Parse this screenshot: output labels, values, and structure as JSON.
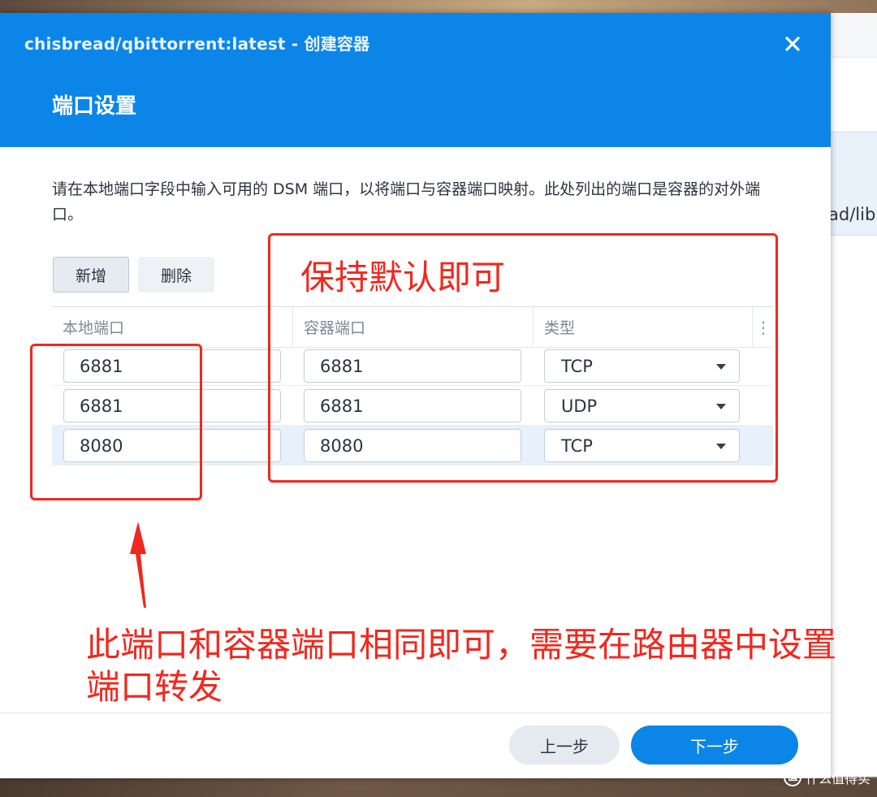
{
  "background": {
    "clipped_text": "ad/lib",
    "watermark": "什么值得买",
    "watermark_logo": "值"
  },
  "dialog": {
    "window_title": "chisbread/qbittorrent:latest - 创建容器",
    "step_title": "端口设置",
    "description": "请在本地端口字段中输入可用的 DSM 端口，以将端口与容器端口映射。此处列出的端口是容器的对外端口。",
    "toolbar": {
      "add_label": "新增",
      "delete_label": "删除"
    },
    "grid": {
      "columns": [
        "本地端口",
        "容器端口",
        "类型"
      ],
      "rows": [
        {
          "local_port": "6881",
          "container_port": "6881",
          "type": "TCP"
        },
        {
          "local_port": "6881",
          "container_port": "6881",
          "type": "UDP"
        },
        {
          "local_port": "8080",
          "container_port": "8080",
          "type": "TCP"
        }
      ],
      "selected_row": 3
    },
    "footer": {
      "prev_label": "上一步",
      "next_label": "下一步"
    }
  },
  "annotations": {
    "keep_default": "保持默认即可",
    "note": "此端口和容器端口相同即可，需要在路由器中设置端口转发"
  },
  "colors": {
    "accent": "#0b86e8",
    "annotation": "#f0281e",
    "selected_row": "#e7f1fc"
  }
}
